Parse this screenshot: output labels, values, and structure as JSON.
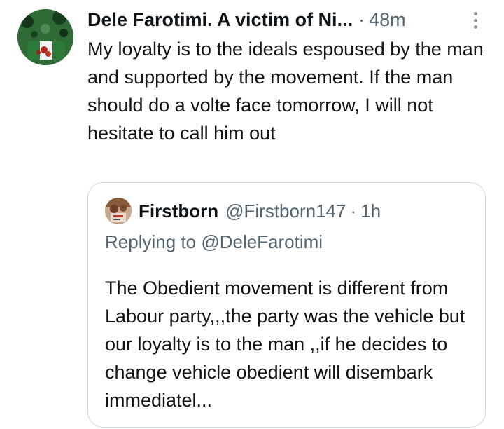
{
  "tweet": {
    "display_name": "Dele Farotimi. A victim of Ni...",
    "separator": "·",
    "time": "48m",
    "text": "My loyalty is to the ideals espoused by the man and supported by the movement. If the man should do a volte face tomorrow, I will not hesitate to call him out",
    "avatar_icon": "flag-avatar",
    "more_icon": "vertical-ellipsis-icon"
  },
  "quoted_tweet": {
    "display_name": "Firstborn",
    "handle": "@Firstborn147",
    "separator": "·",
    "time": "1h",
    "replying_prefix": "Replying to",
    "replying_to": "@DeleFarotimi",
    "text": "The Obedient movement is different from Labour party,,,the party was the vehicle but our loyalty is to the man ,,if he decides to change vehicle obedient will disembark immediatel..."
  },
  "colors": {
    "primary_text": "#0f1419",
    "secondary_text": "#536471",
    "border": "#cfd9de",
    "background": "#ffffff"
  }
}
